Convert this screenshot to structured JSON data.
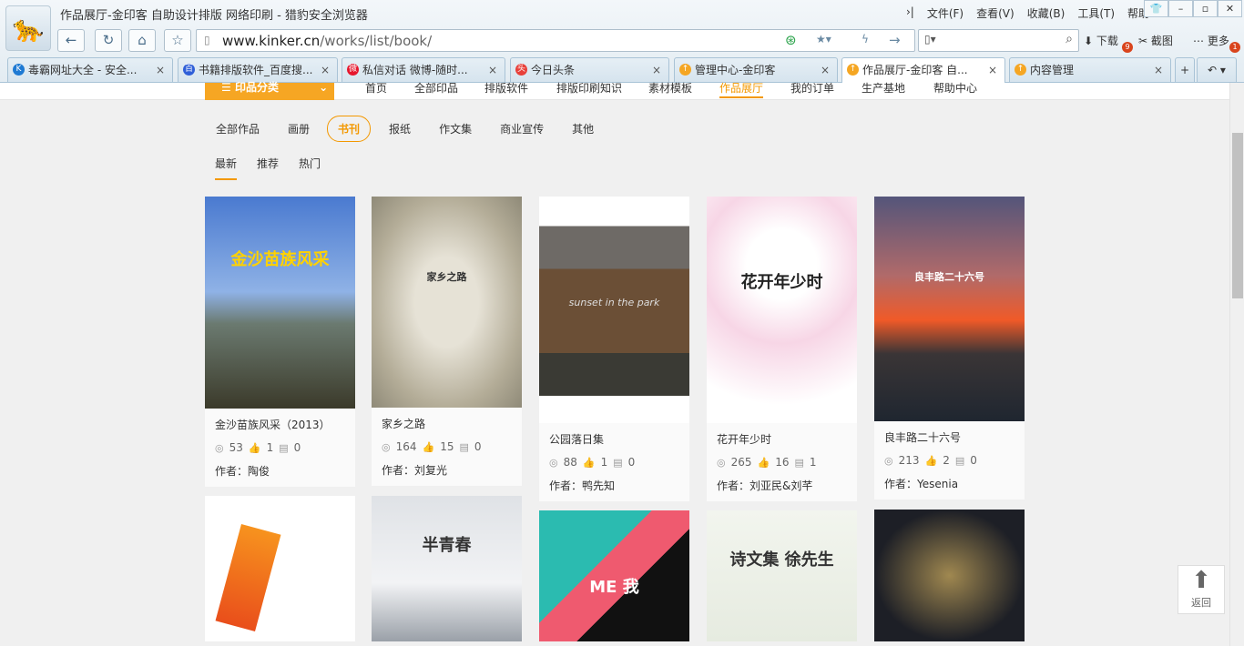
{
  "window": {
    "title": "作品展厅-金印客 自助设计排版 网络印刷 - 猎豹安全浏览器",
    "menu": [
      "文件(F)",
      "查看(V)",
      "收藏(B)",
      "工具(T)",
      "帮助"
    ]
  },
  "address": {
    "domain": "www.kinker.cn",
    "path": "/works/list/book/"
  },
  "tools": {
    "download": "下载",
    "download_badge": "9",
    "screenshot": "截图",
    "more": "更多",
    "more_badge": "1"
  },
  "tabs": [
    {
      "label": "毒霸网址大全 - 安全...",
      "icon": "K",
      "color": "#1e7ad3"
    },
    {
      "label": "书籍排版软件_百度搜...",
      "icon": "百",
      "color": "#2f5fd8"
    },
    {
      "label": "私信对话 微博-随时...",
      "icon": "微",
      "color": "#e6162d"
    },
    {
      "label": "今日头条",
      "icon": "头",
      "color": "#e8403a"
    },
    {
      "label": "管理中心-金印客",
      "icon": "↑",
      "color": "#f5a623"
    },
    {
      "label": "作品展厅-金印客 自...",
      "icon": "↑",
      "color": "#f5a623"
    },
    {
      "label": "内容管理",
      "icon": "↑",
      "color": "#f5a623"
    }
  ],
  "site": {
    "category_button": "印品分类",
    "nav": [
      "首页",
      "全部印品",
      "排版软件",
      "排版印刷知识",
      "素材模板",
      "作品展厅",
      "我的订单",
      "生产基地",
      "帮助中心"
    ],
    "nav_active": 5,
    "filters": [
      "全部作品",
      "画册",
      "书刊",
      "报纸",
      "作文集",
      "商业宣传",
      "其他"
    ],
    "filter_active": 2,
    "sorts": [
      "最新",
      "推荐",
      "热门"
    ],
    "sort_active": 0,
    "accent": "#f39800"
  },
  "works": [
    {
      "title": "金沙苗族风采（2013）",
      "views": "53",
      "likes": "1",
      "comments": "0",
      "author": "作者：陶俊",
      "cover_text": "金沙苗族风采"
    },
    {
      "title": "家乡之路",
      "views": "164",
      "likes": "15",
      "comments": "0",
      "author": "作者：刘复光",
      "cover_text": "家乡之路"
    },
    {
      "title": "公园落日集",
      "views": "88",
      "likes": "1",
      "comments": "0",
      "author": "作者：鸭先知",
      "cover_text": "sunset in the park"
    },
    {
      "title": "花开年少时",
      "views": "265",
      "likes": "16",
      "comments": "1",
      "author": "作者：刘亚民&刘芊",
      "cover_text": "花开年少时"
    },
    {
      "title": "良丰路二十六号",
      "views": "213",
      "likes": "2",
      "comments": "0",
      "author": "作者：Yesenia",
      "cover_text": "良丰路二十六号"
    }
  ],
  "works_row2": [
    {
      "cover_text": ""
    },
    {
      "cover_text": "半青春"
    },
    {
      "cover_text": "ME 我"
    },
    {
      "cover_text": "诗文集 徐先生"
    },
    {
      "cover_text": ""
    }
  ],
  "back_to_top": "返回"
}
